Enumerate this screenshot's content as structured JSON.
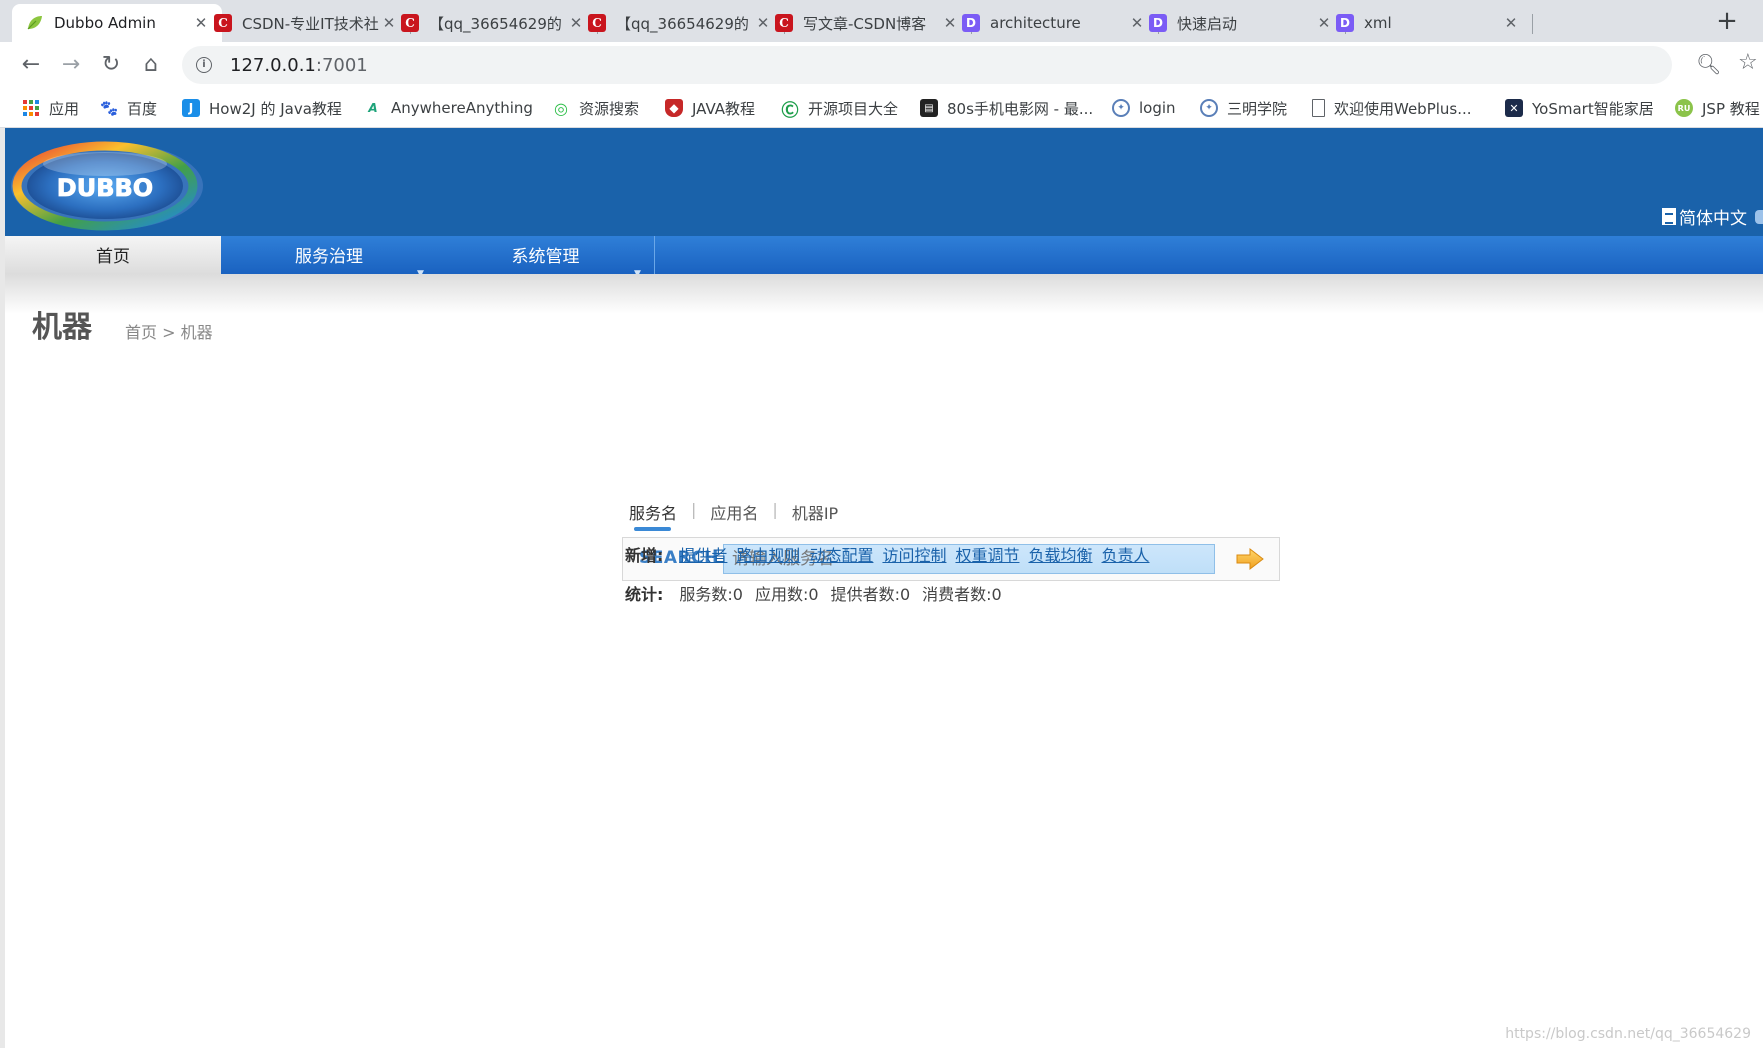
{
  "browser": {
    "tabs": [
      {
        "title": "Dubbo Admin",
        "icon": "leaf-icon",
        "active": true
      },
      {
        "title": "CSDN-专业IT技术社",
        "icon": "csdn-icon",
        "active": false
      },
      {
        "title": "【qq_36654629的",
        "icon": "csdn-icon",
        "active": false
      },
      {
        "title": "【qq_36654629的",
        "icon": "csdn-icon",
        "active": false
      },
      {
        "title": "写文章-CSDN博客",
        "icon": "csdn-icon",
        "active": false
      },
      {
        "title": "architecture",
        "icon": "doc-d-icon",
        "active": false
      },
      {
        "title": "快速启动",
        "icon": "doc-d-icon",
        "active": false
      },
      {
        "title": "xml",
        "icon": "doc-d-icon",
        "active": false
      }
    ],
    "url_host": "127.0.0.1",
    "url_port": ":7001",
    "bookmarks": [
      {
        "label": "应用",
        "icon": "apps-grid-icon"
      },
      {
        "label": "百度",
        "icon": "baidu-paw-icon"
      },
      {
        "label": "How2J 的 Java教程",
        "icon": "how2j-icon"
      },
      {
        "label": "AnywhereAnything",
        "icon": "aa-icon"
      },
      {
        "label": "资源搜索",
        "icon": "search-resource-icon"
      },
      {
        "label": "JAVA教程",
        "icon": "shield-icon"
      },
      {
        "label": "开源项目大全",
        "icon": "open-source-icon"
      },
      {
        "label": "80s手机电影网 - 最...",
        "icon": "clapper-icon"
      },
      {
        "label": "login",
        "icon": "university-seal-icon"
      },
      {
        "label": "三明学院",
        "icon": "university-seal-icon"
      },
      {
        "label": "欢迎使用WebPlus...",
        "icon": "page-icon"
      },
      {
        "label": "YoSmart智能家居",
        "icon": "yosmart-icon"
      },
      {
        "label": "JSP 教程",
        "icon": "runoob-icon"
      }
    ]
  },
  "header": {
    "logo_text": "DUBBO",
    "language": "简体中文"
  },
  "menu": {
    "home": "首页",
    "service_governance": "服务治理",
    "system_management": "系统管理"
  },
  "page": {
    "title": "机器",
    "breadcrumb": "首页 > 机器"
  },
  "search": {
    "tabs": [
      "服务名",
      "应用名",
      "机器IP"
    ],
    "label": "SEARCH",
    "placeholder": "请输入服务名"
  },
  "add_row": {
    "label": "新增:",
    "links": [
      "提供者",
      "路由规则",
      "动态配置",
      "访问控制",
      "权重调节",
      "负载均衡",
      "负责人"
    ]
  },
  "stats_row": {
    "label": "统计:",
    "items": [
      "服务数:0",
      "应用数:0",
      "提供者数:0",
      "消费者数:0"
    ]
  },
  "watermark": "https://blog.csdn.net/qq_36654629",
  "colors": {
    "header_blue": "#1a62aa",
    "menu_blue": "#2f7fd8",
    "link_blue": "#1a62aa",
    "csdn_red": "#c9151e"
  }
}
